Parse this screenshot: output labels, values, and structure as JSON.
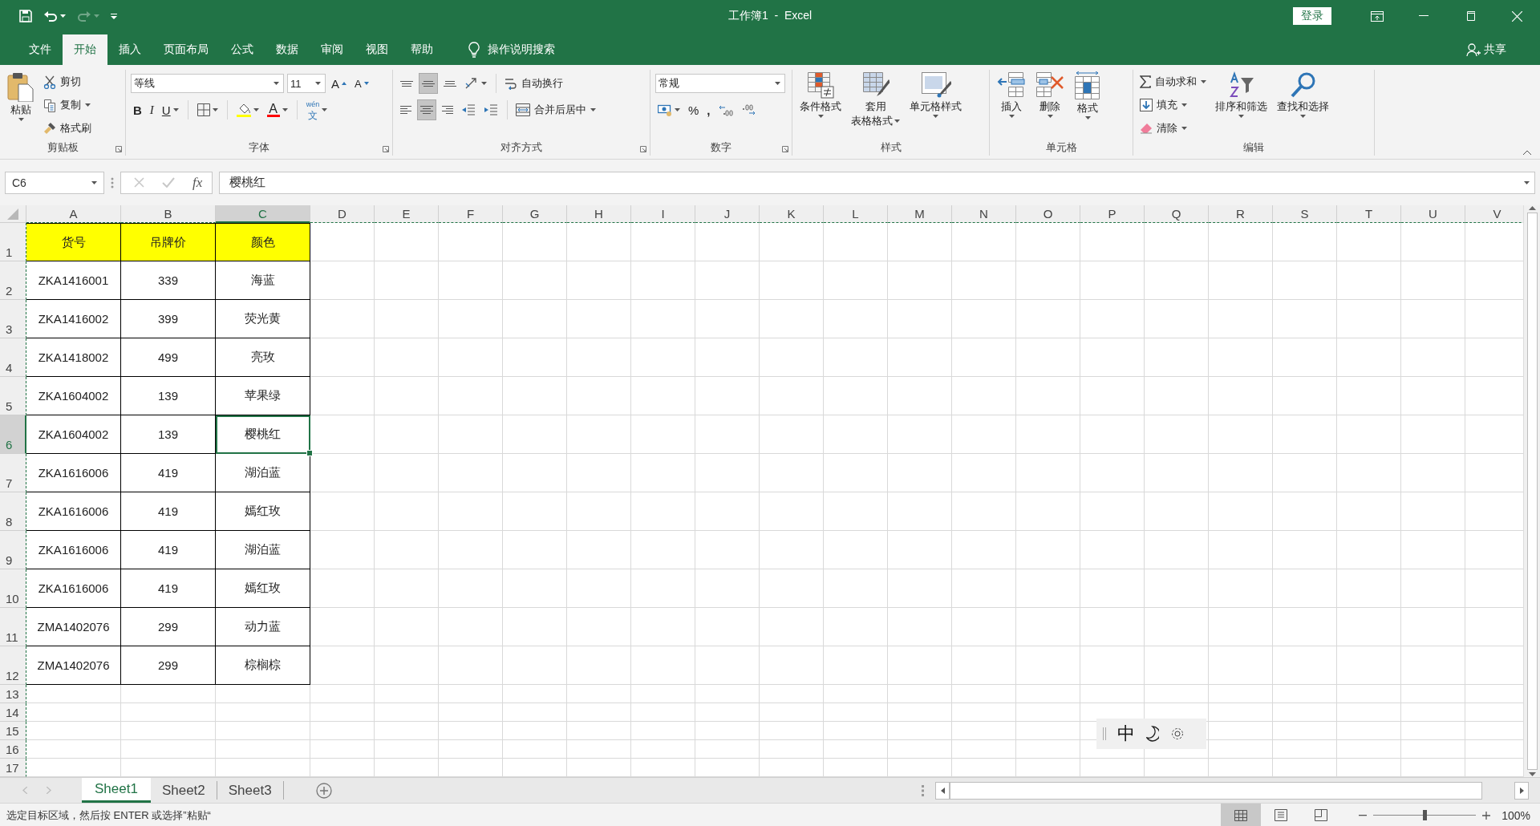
{
  "title_bar": {
    "title": "工作簿1  -  Excel",
    "login_button": "登录"
  },
  "ribbon_tabs": [
    {
      "label": "文件",
      "selected": false
    },
    {
      "label": "开始",
      "selected": true
    },
    {
      "label": "插入",
      "selected": false
    },
    {
      "label": "页面布局",
      "selected": false
    },
    {
      "label": "公式",
      "selected": false
    },
    {
      "label": "数据",
      "selected": false
    },
    {
      "label": "审阅",
      "selected": false
    },
    {
      "label": "视图",
      "selected": false
    },
    {
      "label": "帮助",
      "selected": false
    }
  ],
  "tell_me": "操作说明搜索",
  "share": "共享",
  "clipboard": {
    "paste": "粘贴",
    "cut": "剪切",
    "copy": "复制",
    "format_painter": "格式刷",
    "label": "剪贴板"
  },
  "font": {
    "name": "等线",
    "size": "11",
    "grow": "A",
    "shrink": "A",
    "bold": "B",
    "italic": "I",
    "underline": "U",
    "font_color": "A",
    "phonetic_top": "wén",
    "phonetic": "文",
    "label": "字体"
  },
  "alignment": {
    "vertical_align": [
      {
        "kind": "top",
        "selected": false
      },
      {
        "kind": "middle",
        "selected": true
      },
      {
        "kind": "bottom",
        "selected": false
      }
    ],
    "horizontal_align": [
      {
        "kind": "left",
        "selected": false
      },
      {
        "kind": "center",
        "selected": true
      },
      {
        "kind": "right",
        "selected": false
      }
    ],
    "wrap_text": "自动换行",
    "merge_center": "合并后居中",
    "label": "对齐方式"
  },
  "number": {
    "format": "常规",
    "percent": "%",
    "comma": ",",
    "label": "数字"
  },
  "styles": {
    "conditional": "条件格式",
    "table_top": "套用",
    "table_bottom": "表格格式",
    "cell_styles": "单元格样式",
    "label": "样式"
  },
  "cells": {
    "insert": "插入",
    "delete": "删除",
    "format": "格式",
    "label": "单元格"
  },
  "editing": {
    "autosum": "自动求和",
    "fill": "填充",
    "clear": "清除",
    "sort_filter": "排序和筛选",
    "find_select": "查找和选择",
    "label": "编辑"
  },
  "formula_bar": {
    "name_box": "C6",
    "function_label": "fx",
    "value": "樱桃红"
  },
  "columns": [
    {
      "label": "A",
      "selected": false
    },
    {
      "label": "B",
      "selected": false
    },
    {
      "label": "C",
      "selected": true
    },
    {
      "label": "D",
      "selected": false
    },
    {
      "label": "E",
      "selected": false
    },
    {
      "label": "F",
      "selected": false
    },
    {
      "label": "G",
      "selected": false
    },
    {
      "label": "H",
      "selected": false
    },
    {
      "label": "I",
      "selected": false
    },
    {
      "label": "J",
      "selected": false
    },
    {
      "label": "K",
      "selected": false
    },
    {
      "label": "L",
      "selected": false
    },
    {
      "label": "M",
      "selected": false
    },
    {
      "label": "N",
      "selected": false
    },
    {
      "label": "O",
      "selected": false
    },
    {
      "label": "P",
      "selected": false
    },
    {
      "label": "Q",
      "selected": false
    },
    {
      "label": "R",
      "selected": false
    },
    {
      "label": "S",
      "selected": false
    },
    {
      "label": "T",
      "selected": false
    },
    {
      "label": "U",
      "selected": false
    },
    {
      "label": "V",
      "selected": false
    }
  ],
  "rows": [
    {
      "header": "1",
      "kind": "header",
      "selected": false,
      "cells": [
        "货号",
        "吊牌价",
        "颜色"
      ]
    },
    {
      "header": "2",
      "kind": "data",
      "selected": false,
      "cells": [
        "ZKA1416001",
        "339",
        "海蓝"
      ]
    },
    {
      "header": "3",
      "kind": "data",
      "selected": false,
      "cells": [
        "ZKA1416002",
        "399",
        "荧光黄"
      ]
    },
    {
      "header": "4",
      "kind": "data",
      "selected": false,
      "cells": [
        "ZKA1418002",
        "499",
        "亮玫"
      ]
    },
    {
      "header": "5",
      "kind": "data",
      "selected": false,
      "cells": [
        "ZKA1604002",
        "139",
        "苹果绿"
      ]
    },
    {
      "header": "6",
      "kind": "data",
      "selected": true,
      "cells": [
        "ZKA1604002",
        "139",
        "樱桃红"
      ]
    },
    {
      "header": "7",
      "kind": "data",
      "selected": false,
      "cells": [
        "ZKA1616006",
        "419",
        "湖泊蓝"
      ]
    },
    {
      "header": "8",
      "kind": "data",
      "selected": false,
      "cells": [
        "ZKA1616006",
        "419",
        "嫣红玫"
      ]
    },
    {
      "header": "9",
      "kind": "data",
      "selected": false,
      "cells": [
        "ZKA1616006",
        "419",
        "湖泊蓝"
      ]
    },
    {
      "header": "10",
      "kind": "data",
      "selected": false,
      "cells": [
        "ZKA1616006",
        "419",
        "嫣红玫"
      ]
    },
    {
      "header": "11",
      "kind": "data",
      "selected": false,
      "cells": [
        "ZMA1402076",
        "299",
        "动力蓝"
      ]
    },
    {
      "header": "12",
      "kind": "data",
      "selected": false,
      "cells": [
        "ZMA1402076",
        "299",
        "棕榈棕"
      ]
    },
    {
      "header": "13",
      "kind": "empty",
      "selected": false
    },
    {
      "header": "14",
      "kind": "empty",
      "selected": false
    },
    {
      "header": "15",
      "kind": "empty",
      "selected": false
    },
    {
      "header": "16",
      "kind": "empty",
      "selected": false
    },
    {
      "header": "17",
      "kind": "empty",
      "selected": false
    }
  ],
  "sheet_tabs": [
    {
      "label": "Sheet1",
      "selected": true
    },
    {
      "label": "Sheet2",
      "selected": false
    },
    {
      "label": "Sheet3",
      "selected": false
    }
  ],
  "status_bar": {
    "message": "选定目标区域，然后按 ENTER 或选择”粘贴“",
    "views": [
      {
        "kind": "normal",
        "selected": true
      },
      {
        "kind": "page_layout",
        "selected": false
      },
      {
        "kind": "page_break",
        "selected": false
      }
    ],
    "zoom": {
      "level": 0.5,
      "reading": "100%"
    }
  },
  "ime": {
    "mode": "中"
  }
}
